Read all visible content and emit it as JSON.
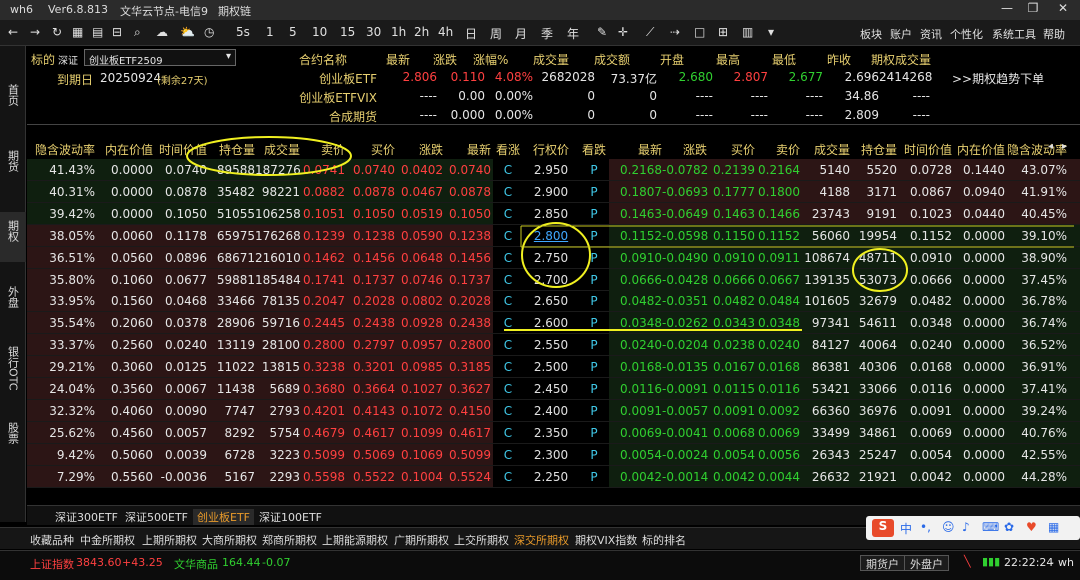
{
  "titlebar": {
    "app": "wh6",
    "version": "Ver6.8.813",
    "node": "文华云节点-电信9",
    "page": "期权链",
    "min_icon": "minimize-icon",
    "max_icon": "maximize-icon",
    "close_icon": "close-icon"
  },
  "toolbar": {
    "periods": [
      "1",
      "5",
      "10",
      "15",
      "30",
      "1h",
      "2h",
      "4h",
      "日",
      "周",
      "月",
      "季",
      "年"
    ],
    "seconds": "5s",
    "right_menu": [
      "板块",
      "账户",
      "资讯",
      "个性化",
      "系统工具",
      "帮助"
    ]
  },
  "leftbar": [
    "首页",
    "期货",
    "期权",
    "外盘",
    "银行OTC",
    "股票"
  ],
  "info": {
    "underlying_label": "标的",
    "exchange": "深证",
    "underlying_select": "创业板ETF2509",
    "expiry_label": "到期日",
    "expiry_date": "20250924",
    "days_left": "(剩余27天)",
    "headers": [
      "合约名称",
      "最新",
      "涨跌",
      "涨幅%",
      "成交量",
      "成交额",
      "开盘",
      "最高",
      "最低",
      "昨收",
      "期权成交量"
    ],
    "rows": [
      {
        "name": "创业板ETF",
        "last": "2.806",
        "chg": "0.110",
        "pct": "4.08%",
        "vol": "2682028",
        "amt": "73.37亿",
        "open": "2.680",
        "high": "2.807",
        "low": "2.677",
        "prev": "2.696",
        "opt_vol": "2414268"
      },
      {
        "name": "创业板ETFVIX",
        "last": "----",
        "chg": "0.00",
        "pct": "0.00%",
        "vol": "0",
        "amt": "0",
        "open": "----",
        "high": "----",
        "low": "----",
        "prev": "34.86",
        "opt_vol": "----"
      },
      {
        "name": "合成期货",
        "last": "----",
        "chg": "0.000",
        "pct": "0.00%",
        "vol": "0",
        "amt": "0",
        "open": "----",
        "high": "----",
        "low": "----",
        "prev": "2.809",
        "opt_vol": "----"
      }
    ],
    "trend_link": ">>期权趋势下单"
  },
  "table": {
    "headers": [
      "隐含波动率",
      "内在价值",
      "时间价值",
      "持仓量",
      "成交量",
      "卖价",
      "买价",
      "涨跌",
      "最新",
      "看涨",
      "行权价",
      "看跌",
      "最新",
      "涨跌",
      "买价",
      "卖价",
      "成交量",
      "持仓量",
      "时间价值",
      "内在价值",
      "隐含波动率"
    ],
    "rows": [
      {
        "c": [
          "41.43%",
          "0.0000",
          "0.0740",
          "89588",
          "187276",
          "0.0741",
          "0.0740",
          "0.0402",
          "0.0740"
        ],
        "k": "2.950",
        "p": [
          "0.2168",
          "-0.0782",
          "0.2139",
          "0.2164",
          "5140",
          "5520",
          "0.0728",
          "0.1440",
          "43.07%"
        ]
      },
      {
        "c": [
          "40.31%",
          "0.0000",
          "0.0878",
          "35482",
          "98221",
          "0.0882",
          "0.0878",
          "0.0467",
          "0.0878"
        ],
        "k": "2.900",
        "p": [
          "0.1807",
          "-0.0693",
          "0.1777",
          "0.1800",
          "4188",
          "3171",
          "0.0867",
          "0.0940",
          "41.91%"
        ]
      },
      {
        "c": [
          "39.42%",
          "0.0000",
          "0.1050",
          "51055",
          "106258",
          "0.1051",
          "0.1050",
          "0.0519",
          "0.1050"
        ],
        "k": "2.850",
        "p": [
          "0.1463",
          "-0.0649",
          "0.1463",
          "0.1466",
          "23743",
          "9191",
          "0.1023",
          "0.0440",
          "40.45%"
        ]
      },
      {
        "c": [
          "38.05%",
          "0.0060",
          "0.1178",
          "65975",
          "176268",
          "0.1239",
          "0.1238",
          "0.0590",
          "0.1238"
        ],
        "k": "2.800",
        "p": [
          "0.1152",
          "-0.0598",
          "0.1150",
          "0.1152",
          "56060",
          "19954",
          "0.1152",
          "0.0000",
          "39.10%"
        ]
      },
      {
        "c": [
          "36.51%",
          "0.0560",
          "0.0896",
          "68671",
          "216010",
          "0.1462",
          "0.1456",
          "0.0648",
          "0.1456"
        ],
        "k": "2.750",
        "p": [
          "0.0910",
          "-0.0490",
          "0.0910",
          "0.0911",
          "108674",
          "48711",
          "0.0910",
          "0.0000",
          "38.90%"
        ]
      },
      {
        "c": [
          "35.80%",
          "0.1060",
          "0.0677",
          "59881",
          "185484",
          "0.1741",
          "0.1737",
          "0.0746",
          "0.1737"
        ],
        "k": "2.700",
        "p": [
          "0.0666",
          "-0.0428",
          "0.0666",
          "0.0667",
          "139135",
          "53073",
          "0.0666",
          "0.0000",
          "37.45%"
        ]
      },
      {
        "c": [
          "33.95%",
          "0.1560",
          "0.0468",
          "33466",
          "78135",
          "0.2047",
          "0.2028",
          "0.0802",
          "0.2028"
        ],
        "k": "2.650",
        "p": [
          "0.0482",
          "-0.0351",
          "0.0482",
          "0.0484",
          "101605",
          "32679",
          "0.0482",
          "0.0000",
          "36.78%"
        ]
      },
      {
        "c": [
          "35.54%",
          "0.2060",
          "0.0378",
          "28906",
          "59716",
          "0.2445",
          "0.2438",
          "0.0928",
          "0.2438"
        ],
        "k": "2.600",
        "p": [
          "0.0348",
          "-0.0262",
          "0.0343",
          "0.0348",
          "97341",
          "54611",
          "0.0348",
          "0.0000",
          "36.74%"
        ]
      },
      {
        "c": [
          "33.37%",
          "0.2560",
          "0.0240",
          "13119",
          "28100",
          "0.2800",
          "0.2797",
          "0.0957",
          "0.2800"
        ],
        "k": "2.550",
        "p": [
          "0.0240",
          "-0.0204",
          "0.0238",
          "0.0240",
          "84127",
          "40064",
          "0.0240",
          "0.0000",
          "36.52%"
        ]
      },
      {
        "c": [
          "29.21%",
          "0.3060",
          "0.0125",
          "11022",
          "13815",
          "0.3238",
          "0.3201",
          "0.0985",
          "0.3185"
        ],
        "k": "2.500",
        "p": [
          "0.0168",
          "-0.0135",
          "0.0167",
          "0.0168",
          "86381",
          "40306",
          "0.0168",
          "0.0000",
          "36.91%"
        ]
      },
      {
        "c": [
          "24.04%",
          "0.3560",
          "0.0067",
          "11438",
          "5689",
          "0.3680",
          "0.3664",
          "0.1027",
          "0.3627"
        ],
        "k": "2.450",
        "p": [
          "0.0116",
          "-0.0091",
          "0.0115",
          "0.0116",
          "53421",
          "33066",
          "0.0116",
          "0.0000",
          "37.41%"
        ]
      },
      {
        "c": [
          "32.32%",
          "0.4060",
          "0.0090",
          "7747",
          "2793",
          "0.4201",
          "0.4143",
          "0.1072",
          "0.4150"
        ],
        "k": "2.400",
        "p": [
          "0.0091",
          "-0.0057",
          "0.0091",
          "0.0092",
          "66360",
          "36976",
          "0.0091",
          "0.0000",
          "39.24%"
        ]
      },
      {
        "c": [
          "25.62%",
          "0.4560",
          "0.0057",
          "8292",
          "5754",
          "0.4679",
          "0.4617",
          "0.1099",
          "0.4617"
        ],
        "k": "2.350",
        "p": [
          "0.0069",
          "-0.0041",
          "0.0068",
          "0.0069",
          "33499",
          "34861",
          "0.0069",
          "0.0000",
          "40.76%"
        ]
      },
      {
        "c": [
          "9.42%",
          "0.5060",
          "0.0039",
          "6728",
          "3223",
          "0.5099",
          "0.5069",
          "0.1069",
          "0.5099"
        ],
        "k": "2.300",
        "p": [
          "0.0054",
          "-0.0024",
          "0.0054",
          "0.0056",
          "26343",
          "25247",
          "0.0054",
          "0.0000",
          "42.55%"
        ]
      },
      {
        "c": [
          "7.29%",
          "0.5560",
          "-0.0036",
          "5167",
          "2293",
          "0.5598",
          "0.5522",
          "0.1004",
          "0.5524"
        ],
        "k": "2.250",
        "p": [
          "0.0042",
          "-0.0014",
          "0.0042",
          "0.0044",
          "26632",
          "21921",
          "0.0042",
          "0.0000",
          "44.28%"
        ]
      }
    ],
    "call_letter": "C",
    "put_letter": "P"
  },
  "etf_tabs": [
    "深证300ETF",
    "深证500ETF",
    "创业板ETF",
    "深证100ETF"
  ],
  "market_tabs": [
    "收藏品种",
    "中金所期权",
    "上期所期权",
    "大商所期权",
    "郑商所期权",
    "上期能源期权",
    "广期所期权",
    "上交所期权",
    "深交所期权",
    "期权VIX指数",
    "标的排名"
  ],
  "status": {
    "index1_name": "上证指数",
    "index1_value": "3843.60",
    "index1_chg": "+43.25",
    "index2_name": "文华商品",
    "index2_value": "164.44",
    "index2_chg": "-0.07",
    "btn1": "期货户",
    "btn2": "外盘户",
    "time": "22:22:24",
    "user": "wh"
  },
  "ime": {
    "lang": "中",
    "punct": "•,"
  },
  "colors": {
    "red": "#ff4040",
    "green": "#30d030",
    "yellow": "#e8d070",
    "cyan": "#40c8e8",
    "accent": "#e89a2a"
  }
}
